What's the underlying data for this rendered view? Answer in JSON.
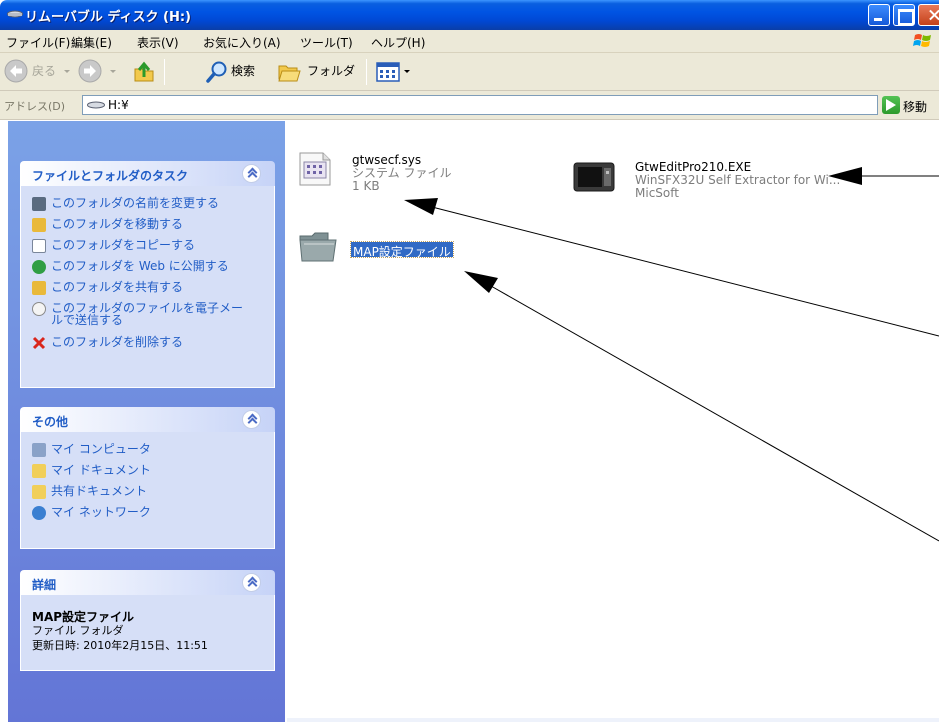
{
  "window": {
    "title": "リムーバブル ディスク (H:)",
    "controls": [
      "minimize",
      "maximize",
      "close"
    ]
  },
  "menu": [
    "ファイル(F)",
    "編集(E)",
    "表示(V)",
    "お気に入り(A)",
    "ツール(T)",
    "ヘルプ(H)"
  ],
  "toolbar": {
    "back_label": "戻る",
    "search_label": "検索",
    "folders_label": "フォルダ"
  },
  "address": {
    "label": "アドレス(D)",
    "value": "H:¥",
    "go_label": "移動"
  },
  "tasks_panel": {
    "title": "ファイルとフォルダのタスク",
    "items": [
      {
        "label": "このフォルダの名前を変更する",
        "icon": "rename-icon"
      },
      {
        "label": "このフォルダを移動する",
        "icon": "move-icon"
      },
      {
        "label": "このフォルダをコピーする",
        "icon": "copy-icon"
      },
      {
        "label": "このフォルダを Web に公開する",
        "icon": "web-publish-icon"
      },
      {
        "label": "このフォルダを共有する",
        "icon": "share-icon"
      },
      {
        "label": "このフォルダのファイルを電子メー",
        "label2": "ルで送信する",
        "icon": "email-icon"
      },
      {
        "label": "このフォルダを削除する",
        "icon": "delete-icon"
      }
    ]
  },
  "other_panel": {
    "title": "その他",
    "items": [
      {
        "label": "マイ コンピュータ",
        "icon": "my-computer-icon"
      },
      {
        "label": "マイ ドキュメント",
        "icon": "my-documents-icon"
      },
      {
        "label": "共有ドキュメント",
        "icon": "shared-documents-icon"
      },
      {
        "label": "マイ ネットワーク",
        "icon": "my-network-icon"
      }
    ]
  },
  "details_panel": {
    "title": "詳細",
    "name": "MAP設定ファイル",
    "type": "ファイル フォルダ",
    "modified": "更新日時: 2010年2月15日、11:51"
  },
  "files": [
    {
      "name": "gtwsecf.sys",
      "type": "システム ファイル",
      "size": "1 KB",
      "icon": "system-file-icon"
    },
    {
      "name": "GtwEditPro210.EXE",
      "description": "WinSFX32U Self Extractor for Wi...",
      "company": "MicSoft",
      "icon": "installer-exe-icon"
    },
    {
      "name": "MAP設定ファイル",
      "icon": "folder-icon",
      "selected": true
    }
  ],
  "colors": {
    "titlebar": "#0054e3",
    "taskpane_gradient_top": "#7ba2e7",
    "taskpane_gradient_bottom": "#6375d6",
    "task_link": "#215dc6",
    "selection": "#316ac5"
  }
}
